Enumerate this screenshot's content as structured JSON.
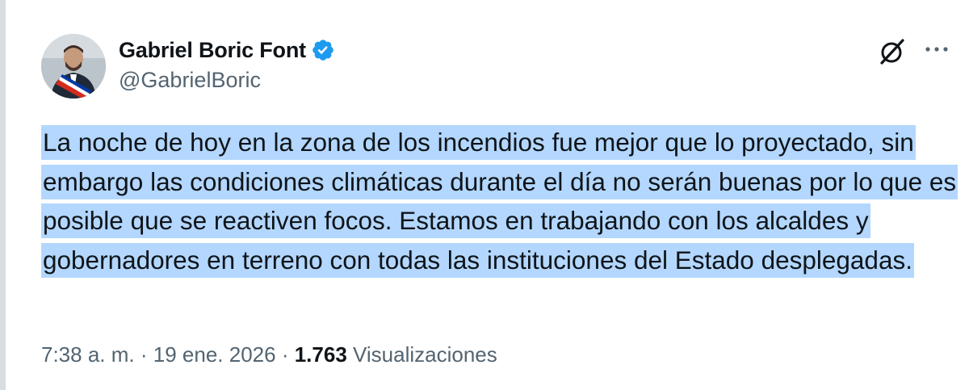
{
  "author": {
    "name": "Gabriel Boric Font",
    "handle": "@GabrielBoric",
    "verified": true,
    "verified_color": "#1d9bf0"
  },
  "tweet": {
    "text": "La noche de hoy en la zona de los incendios fue mejor que lo proyectado, sin embargo las condiciones climáticas durante el día no serán buenas por lo que es posible que se reactiven focos. Estamos en trabajando con los alcaldes y gobernadores en terreno con todas las instituciones del Estado desplegadas.",
    "selection_color": "#b3d7fe"
  },
  "meta": {
    "time": "7:38 a. m.",
    "separator": "·",
    "date": "19 ene. 2026",
    "views_count": "1.763",
    "views_label": "Visualizaciones"
  },
  "icons": {
    "grok": "grok-icon",
    "more": "more-options-icon",
    "verified": "verified-badge-icon"
  }
}
